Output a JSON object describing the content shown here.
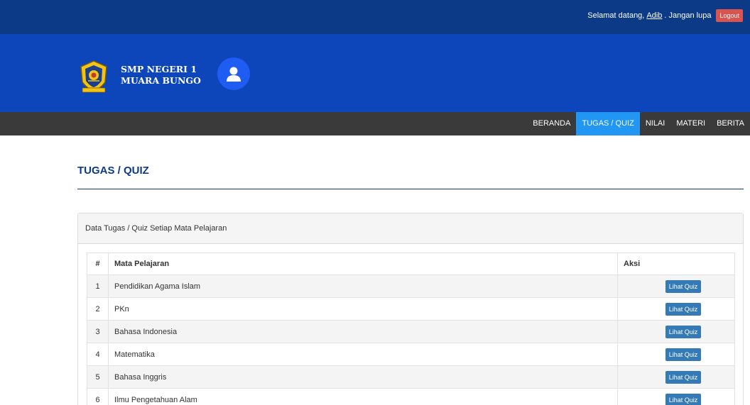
{
  "topbar": {
    "welcome_prefix": "Selamat datang,",
    "username": "Adib",
    "welcome_suffix": ". Jangan lupa",
    "logout_label": "Logout"
  },
  "banner": {
    "school_line1": "SMP NEGERI 1",
    "school_line2": "MUARA BUNGO"
  },
  "nav": {
    "items": [
      {
        "label": "BERANDA",
        "active": false
      },
      {
        "label": "TUGAS / QUIZ",
        "active": true
      },
      {
        "label": "NILAI",
        "active": false
      },
      {
        "label": "MATERI",
        "active": false
      },
      {
        "label": "BERITA",
        "active": false
      }
    ]
  },
  "page": {
    "title": "TUGAS / QUIZ"
  },
  "panel": {
    "heading": "Data Tugas / Quiz Setiap Mata Pelajaran",
    "columns": [
      "#",
      "Mata Pelajaran",
      "Aksi"
    ],
    "button_label": "Lihat Quiz",
    "rows": [
      {
        "no": "1",
        "subject": "Pendidikan Agama Islam"
      },
      {
        "no": "2",
        "subject": "PKn"
      },
      {
        "no": "3",
        "subject": "Bahasa Indonesia"
      },
      {
        "no": "4",
        "subject": "Matematika"
      },
      {
        "no": "5",
        "subject": "Bahasa Inggris"
      },
      {
        "no": "6",
        "subject": "Ilmu Pengetahuan Alam"
      }
    ]
  },
  "colors": {
    "topbar": "#0d3a86",
    "banner": "#0c46ba",
    "navbar": "#3a3a3a",
    "nav_active": "#2196f3",
    "logout": "#d9534f",
    "quiz_button": "#337ab7"
  }
}
